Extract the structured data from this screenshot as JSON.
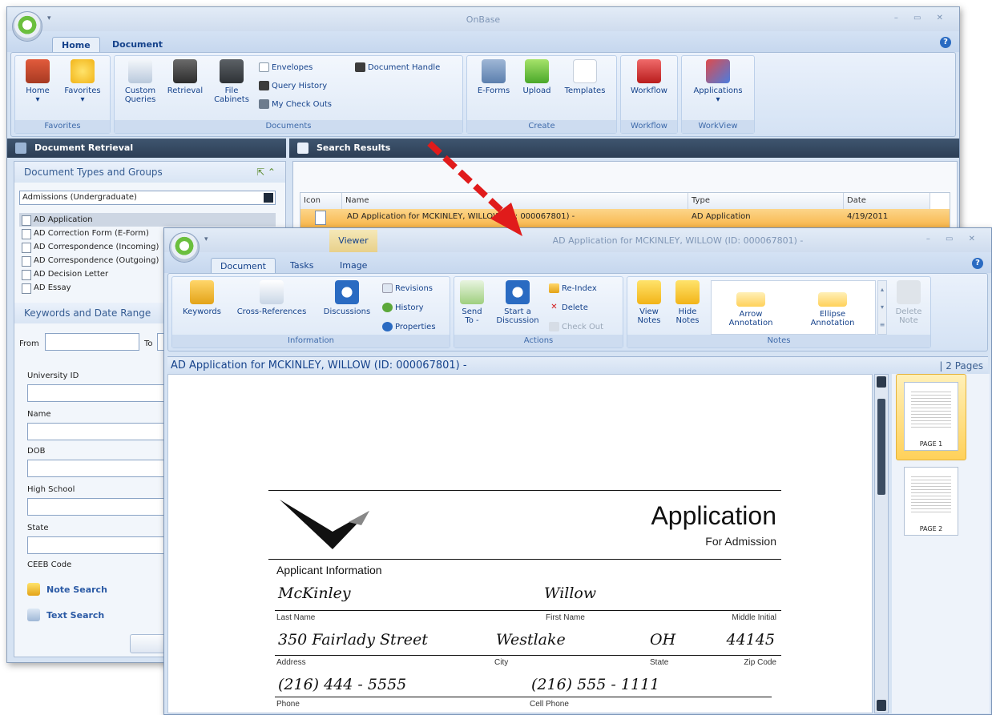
{
  "app": {
    "title": "OnBase",
    "win_controls": "– ▭ ✕"
  },
  "tabs": {
    "home": "Home",
    "document": "Document"
  },
  "ribbon1": {
    "favorites_group": "Favorites",
    "home": "Home",
    "favorites": "Favorites",
    "documents_group": "Documents",
    "custom_queries": "Custom\nQueries",
    "retrieval": "Retrieval",
    "file_cabinets": "File\nCabinets",
    "envelopes": "Envelopes",
    "query_history": "Query History",
    "my_check_outs": "My Check Outs",
    "document_handle": "Document Handle",
    "create_group": "Create",
    "eforms": "E-Forms",
    "upload": "Upload",
    "templates": "Templates",
    "workflow_group": "Workflow",
    "workflow": "Workflow",
    "workview_group": "WorkView",
    "applications": "Applications"
  },
  "left": {
    "header": "Document Retrieval",
    "types_section": "Document Types and Groups",
    "group_select": "Admissions (Undergraduate)",
    "doc_types": [
      "AD Application",
      "AD Correction Form (E-Form)",
      "AD Correspondence (Incoming)",
      "AD Correspondence (Outgoing)",
      "AD Decision Letter",
      "AD Essay"
    ],
    "keywords_section": "Keywords and Date Range",
    "from": "From",
    "to": "To",
    "fields": [
      "University ID",
      "Name",
      "DOB",
      "High School",
      "State",
      "CEEB Code"
    ],
    "note_search": "Note Search",
    "text_search": "Text Search"
  },
  "results": {
    "header": "Search Results",
    "columns": [
      "Icon",
      "Name",
      "Type",
      "Date"
    ],
    "row": {
      "name": "AD Application for MCKINLEY, WILLOW (ID: 000067801) -",
      "type": "AD Application",
      "date": "4/19/2011"
    }
  },
  "viewer": {
    "title": "AD Application for MCKINLEY, WILLOW (ID: 000067801) -",
    "context_tab": "Viewer",
    "tabs": {
      "document": "Document",
      "tasks": "Tasks",
      "image": "Image"
    },
    "ribbon": {
      "information_group": "Information",
      "keywords": "Keywords",
      "cross_references": "Cross-References",
      "discussions": "Discussions",
      "revisions": "Revisions",
      "history": "History",
      "properties": "Properties",
      "actions_group": "Actions",
      "send_to": "Send\nTo -",
      "start_discussion": "Start a\nDiscussion",
      "reindex": "Re-Index",
      "delete": "Delete",
      "check_out": "Check Out",
      "notes_group": "Notes",
      "view_notes": "View\nNotes",
      "hide_notes": "Hide\nNotes",
      "arrow_annotation": "Arrow\nAnnotation",
      "ellipse_annotation": "Ellipse\nAnnotation",
      "delete_note": "Delete\nNote"
    },
    "doc_bar_title": "AD Application for MCKINLEY, WILLOW (ID: 000067801) -",
    "page_count": "| 2 Pages",
    "thumbs": [
      "PAGE 1",
      "PAGE 2"
    ]
  },
  "form": {
    "title": "Application",
    "subtitle": "For Admission",
    "section": "Applicant Information",
    "last_name": "McKinley",
    "first_name": "Willow",
    "lbl_last": "Last Name",
    "lbl_first": "First Name",
    "lbl_middle": "Middle Initial",
    "address": "350 Fairlady Street",
    "city": "Westlake",
    "state": "OH",
    "zip": "44145",
    "lbl_address": "Address",
    "lbl_city": "City",
    "lbl_state": "State",
    "lbl_zip": "Zip Code",
    "phone": "(216) 444 - 5555",
    "cell": "(216) 555 - 1111",
    "lbl_phone": "Phone",
    "lbl_cell": "Cell Phone"
  }
}
